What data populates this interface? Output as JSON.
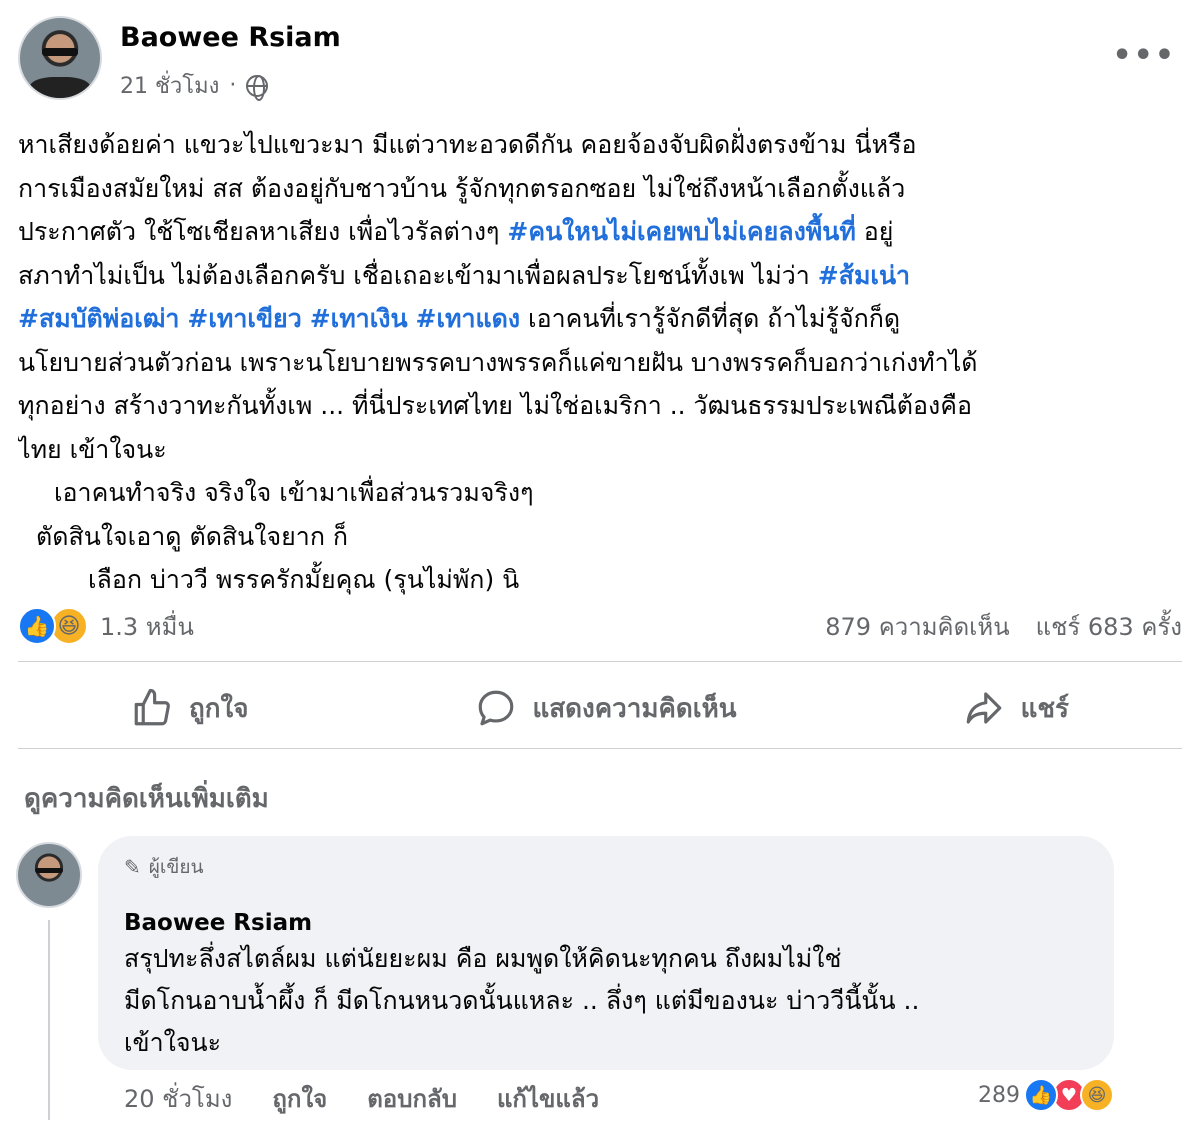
{
  "post": {
    "author": "Baowee Rsiam",
    "time": "21 ชั่วโมง",
    "body": {
      "line1": "หาเสียงด้อยค่า แขวะไปแขวะมา มีแต่วาทะอวดดีกัน คอยจ้องจับผิดฝั่งตรงข้าม นี่หรือ",
      "line2": "การเมืองสมัยใหม่ สส ต้องอยู่กับชาวบ้าน รู้จักทุกตรอกซอย ไม่ใช่ถึงหน้าเลือกตั้งแล้ว",
      "line3_a": "ประกาศตัว ใช้โซเชียลหาเสียง เพื่อไวรัลต่างๆ ",
      "line3_tag": "#คนใหนไม่เคยพบไม่เคยลงพื้นที่",
      "line3_b": " อยู่",
      "line4_a": "สภาทำไม่เป็น ไม่ต้องเลือกครับ เชื่อเถอะเข้ามาเพื่อผลประโยชน์ทั้งเพ ไม่ว่า ",
      "line4_tag": "#ส้มเน่า",
      "line5_tag1": "#สมบัติพ่อเฒ่า",
      "line5_tag2": "#เทาเขียว",
      "line5_tag3": "#เทาเงิน",
      "line5_tag4": "#เทาแดง",
      "line5_b": "  เอาคนที่เรารู้จักดีที่สุด ถ้าไม่รู้จักก็ดู",
      "line6": "นโยบายส่วนตัวก่อน เพราะนโยบายพรรคบางพรรคก็แค่ขายฝัน บางพรรคก็บอกว่าเก่งทำได้",
      "line7": "ทุกอย่าง สร้างวาทะกันทั้งเพ ... ที่นี่ประเทศไทย ไม่ใช่อเมริกา .. วัฒนธรรมประเพณีต้องคือ",
      "line8": "ไทย เข้าใจนะ",
      "line9": "เอาคนทำจริง จริงใจ เข้ามาเพื่อส่วนรวมจริงๆ",
      "line10": "ตัดสินใจเอาดู ตัดสินใจยาก ก็",
      "line11": "เลือก บ่าววี พรรครักมั้ยคุณ (รุนไม่พัก) นิ"
    },
    "reactions_count": "1.3 หมื่น",
    "comments_count": "879 ความคิดเห็น",
    "shares_count": "แชร์ 683 ครั้ง"
  },
  "actions": {
    "like": "ถูกใจ",
    "comment": "แสดงความคิดเห็น",
    "share": "แชร์"
  },
  "more_comments": "ดูความคิดเห็นเพิ่มเติม",
  "comment": {
    "badge": "ผู้เขียน",
    "author": "Baowee Rsiam",
    "text_line1": "สรุปทะลึ่งสไตล์ผม แต่นัยยะผม คือ ผมพูดให้คิดนะทุกคน ถึงผมไม่ใช่",
    "text_line2": "มีดโกนอาบน้ำผึ้ง ก็ มีดโกนหนวดนั้นแหละ .. ลึ่งๆ แต่มีของนะ บ่าววีนี้นั้น ..",
    "text_line3": "เข้าใจนะ",
    "time": "20 ชั่วโมง",
    "like": "ถูกใจ",
    "reply": "ตอบกลับ",
    "edited": "แก้ไขแล้ว",
    "reactions_count": "289"
  },
  "colors": {
    "hashtag": "#216fdb",
    "like_blue": "#1877f2",
    "muted": "#65676b",
    "bubble": "#f0f2f5"
  }
}
